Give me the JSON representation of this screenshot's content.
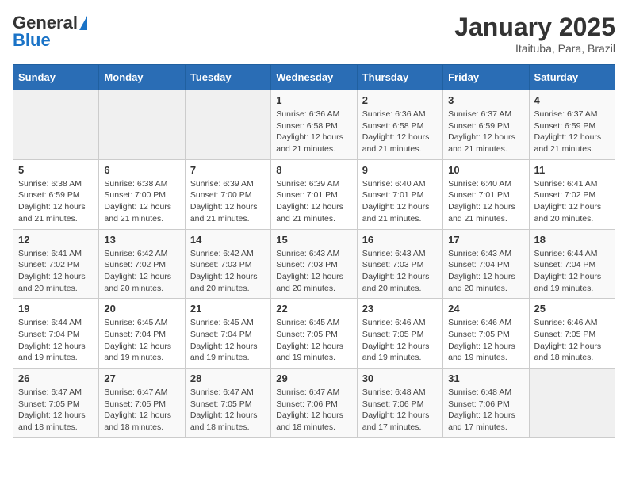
{
  "header": {
    "logo_general": "General",
    "logo_blue": "Blue",
    "month_title": "January 2025",
    "location": "Itaituba, Para, Brazil"
  },
  "days_of_week": [
    "Sunday",
    "Monday",
    "Tuesday",
    "Wednesday",
    "Thursday",
    "Friday",
    "Saturday"
  ],
  "weeks": [
    [
      {
        "day": "",
        "info": ""
      },
      {
        "day": "",
        "info": ""
      },
      {
        "day": "",
        "info": ""
      },
      {
        "day": "1",
        "info": "Sunrise: 6:36 AM\nSunset: 6:58 PM\nDaylight: 12 hours and 21 minutes."
      },
      {
        "day": "2",
        "info": "Sunrise: 6:36 AM\nSunset: 6:58 PM\nDaylight: 12 hours and 21 minutes."
      },
      {
        "day": "3",
        "info": "Sunrise: 6:37 AM\nSunset: 6:59 PM\nDaylight: 12 hours and 21 minutes."
      },
      {
        "day": "4",
        "info": "Sunrise: 6:37 AM\nSunset: 6:59 PM\nDaylight: 12 hours and 21 minutes."
      }
    ],
    [
      {
        "day": "5",
        "info": "Sunrise: 6:38 AM\nSunset: 6:59 PM\nDaylight: 12 hours and 21 minutes."
      },
      {
        "day": "6",
        "info": "Sunrise: 6:38 AM\nSunset: 7:00 PM\nDaylight: 12 hours and 21 minutes."
      },
      {
        "day": "7",
        "info": "Sunrise: 6:39 AM\nSunset: 7:00 PM\nDaylight: 12 hours and 21 minutes."
      },
      {
        "day": "8",
        "info": "Sunrise: 6:39 AM\nSunset: 7:01 PM\nDaylight: 12 hours and 21 minutes."
      },
      {
        "day": "9",
        "info": "Sunrise: 6:40 AM\nSunset: 7:01 PM\nDaylight: 12 hours and 21 minutes."
      },
      {
        "day": "10",
        "info": "Sunrise: 6:40 AM\nSunset: 7:01 PM\nDaylight: 12 hours and 21 minutes."
      },
      {
        "day": "11",
        "info": "Sunrise: 6:41 AM\nSunset: 7:02 PM\nDaylight: 12 hours and 20 minutes."
      }
    ],
    [
      {
        "day": "12",
        "info": "Sunrise: 6:41 AM\nSunset: 7:02 PM\nDaylight: 12 hours and 20 minutes."
      },
      {
        "day": "13",
        "info": "Sunrise: 6:42 AM\nSunset: 7:02 PM\nDaylight: 12 hours and 20 minutes."
      },
      {
        "day": "14",
        "info": "Sunrise: 6:42 AM\nSunset: 7:03 PM\nDaylight: 12 hours and 20 minutes."
      },
      {
        "day": "15",
        "info": "Sunrise: 6:43 AM\nSunset: 7:03 PM\nDaylight: 12 hours and 20 minutes."
      },
      {
        "day": "16",
        "info": "Sunrise: 6:43 AM\nSunset: 7:03 PM\nDaylight: 12 hours and 20 minutes."
      },
      {
        "day": "17",
        "info": "Sunrise: 6:43 AM\nSunset: 7:04 PM\nDaylight: 12 hours and 20 minutes."
      },
      {
        "day": "18",
        "info": "Sunrise: 6:44 AM\nSunset: 7:04 PM\nDaylight: 12 hours and 19 minutes."
      }
    ],
    [
      {
        "day": "19",
        "info": "Sunrise: 6:44 AM\nSunset: 7:04 PM\nDaylight: 12 hours and 19 minutes."
      },
      {
        "day": "20",
        "info": "Sunrise: 6:45 AM\nSunset: 7:04 PM\nDaylight: 12 hours and 19 minutes."
      },
      {
        "day": "21",
        "info": "Sunrise: 6:45 AM\nSunset: 7:04 PM\nDaylight: 12 hours and 19 minutes."
      },
      {
        "day": "22",
        "info": "Sunrise: 6:45 AM\nSunset: 7:05 PM\nDaylight: 12 hours and 19 minutes."
      },
      {
        "day": "23",
        "info": "Sunrise: 6:46 AM\nSunset: 7:05 PM\nDaylight: 12 hours and 19 minutes."
      },
      {
        "day": "24",
        "info": "Sunrise: 6:46 AM\nSunset: 7:05 PM\nDaylight: 12 hours and 19 minutes."
      },
      {
        "day": "25",
        "info": "Sunrise: 6:46 AM\nSunset: 7:05 PM\nDaylight: 12 hours and 18 minutes."
      }
    ],
    [
      {
        "day": "26",
        "info": "Sunrise: 6:47 AM\nSunset: 7:05 PM\nDaylight: 12 hours and 18 minutes."
      },
      {
        "day": "27",
        "info": "Sunrise: 6:47 AM\nSunset: 7:05 PM\nDaylight: 12 hours and 18 minutes."
      },
      {
        "day": "28",
        "info": "Sunrise: 6:47 AM\nSunset: 7:05 PM\nDaylight: 12 hours and 18 minutes."
      },
      {
        "day": "29",
        "info": "Sunrise: 6:47 AM\nSunset: 7:06 PM\nDaylight: 12 hours and 18 minutes."
      },
      {
        "day": "30",
        "info": "Sunrise: 6:48 AM\nSunset: 7:06 PM\nDaylight: 12 hours and 17 minutes."
      },
      {
        "day": "31",
        "info": "Sunrise: 6:48 AM\nSunset: 7:06 PM\nDaylight: 12 hours and 17 minutes."
      },
      {
        "day": "",
        "info": ""
      }
    ]
  ]
}
